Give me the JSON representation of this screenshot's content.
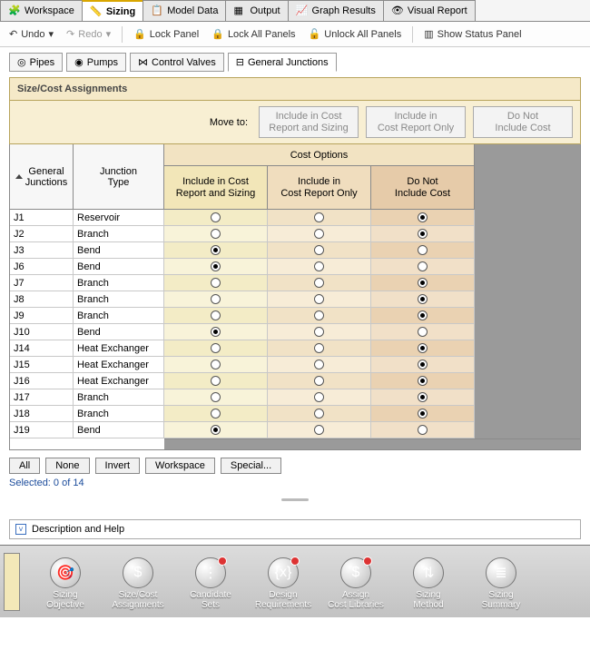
{
  "tabs": {
    "workspace": "Workspace",
    "sizing": "Sizing",
    "model": "Model Data",
    "output": "Output",
    "graph": "Graph Results",
    "visual": "Visual Report"
  },
  "toolbar": {
    "undo": "Undo",
    "redo": "Redo",
    "lock": "Lock Panel",
    "lockAll": "Lock All Panels",
    "unlockAll": "Unlock All Panels",
    "status": "Show Status Panel"
  },
  "subtabs": {
    "pipes": "Pipes",
    "pumps": "Pumps",
    "valves": "Control Valves",
    "gj": "General Junctions"
  },
  "panelTitle": "Size/Cost Assignments",
  "moveTo": {
    "label": "Move to:",
    "b1": "Include in Cost\nReport and Sizing",
    "b2": "Include in\nCost Report Only",
    "b3": "Do Not\nInclude Cost"
  },
  "headers": {
    "gj": "General\nJunctions",
    "jt": "Junction\nType",
    "cost": "Cost Options",
    "o1": "Include in Cost\nReport and Sizing",
    "o2": "Include in\nCost Report Only",
    "o3": "Do Not\nInclude Cost"
  },
  "rows": [
    {
      "id": "J1",
      "type": "Reservoir",
      "sel": 3
    },
    {
      "id": "J2",
      "type": "Branch",
      "sel": 3
    },
    {
      "id": "J3",
      "type": "Bend",
      "sel": 1
    },
    {
      "id": "J6",
      "type": "Bend",
      "sel": 1
    },
    {
      "id": "J7",
      "type": "Branch",
      "sel": 3
    },
    {
      "id": "J8",
      "type": "Branch",
      "sel": 3
    },
    {
      "id": "J9",
      "type": "Branch",
      "sel": 3
    },
    {
      "id": "J10",
      "type": "Bend",
      "sel": 1
    },
    {
      "id": "J14",
      "type": "Heat Exchanger",
      "sel": 3
    },
    {
      "id": "J15",
      "type": "Heat Exchanger",
      "sel": 3
    },
    {
      "id": "J16",
      "type": "Heat Exchanger",
      "sel": 3
    },
    {
      "id": "J17",
      "type": "Branch",
      "sel": 3
    },
    {
      "id": "J18",
      "type": "Branch",
      "sel": 3
    },
    {
      "id": "J19",
      "type": "Bend",
      "sel": 1
    }
  ],
  "selBtns": {
    "all": "All",
    "none": "None",
    "invert": "Invert",
    "workspace": "Workspace",
    "special": "Special..."
  },
  "selText": "Selected: 0 of 14",
  "desc": "Description and Help",
  "nav": [
    {
      "label": "Sizing\nObjective",
      "ico": "🎯"
    },
    {
      "label": "Size/Cost\nAssignments",
      "ico": "$"
    },
    {
      "label": "Candidate\nSets",
      "ico": "⋮",
      "alert": true
    },
    {
      "label": "Design\nRequirements",
      "ico": "{x}",
      "alert": true
    },
    {
      "label": "Assign\nCost Libraries",
      "ico": "$",
      "alert": true
    },
    {
      "label": "Sizing\nMethod",
      "ico": "⇅"
    },
    {
      "label": "Sizing\nSummary",
      "ico": "≣"
    }
  ]
}
